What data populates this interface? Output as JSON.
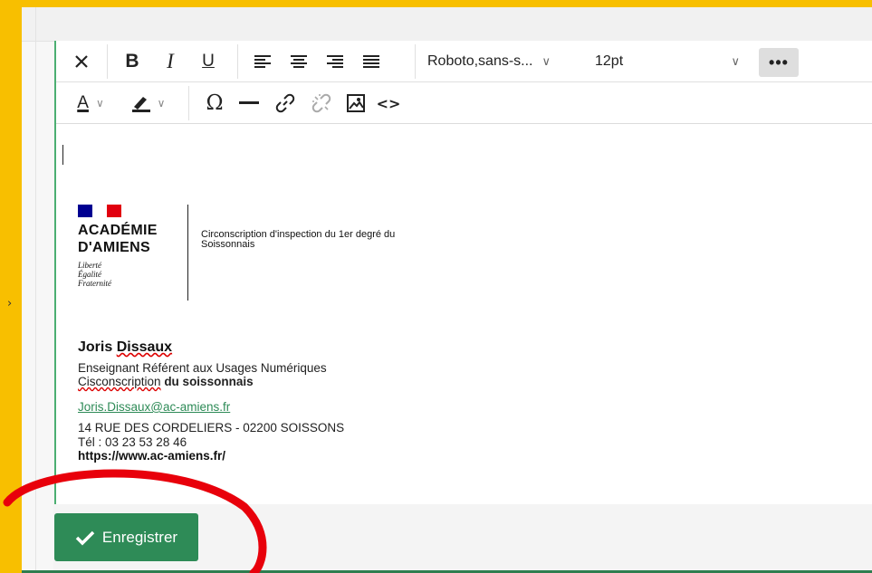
{
  "toolbar": {
    "row1": {
      "clear_icon": "close-icon",
      "bold_label": "B",
      "italic_label": "I",
      "underline_label": "U",
      "font_family": "Roboto,sans-s...",
      "font_size": "12pt",
      "more_label": "•••"
    },
    "row2": {
      "text_color_label": "A",
      "special_char_label": "Ω",
      "hr_label": "—",
      "code_label": "<>"
    }
  },
  "signature": {
    "logo": {
      "line1": "ACADÉMIE",
      "line2": "D'AMIENS",
      "motto1": "Liberté",
      "motto2": "Égalité",
      "motto3": "Fraternité"
    },
    "circonscription_line1": "Circonscription d'inspection du 1er degré du",
    "circonscription_line2": "Soissonnais",
    "name_first": "Joris",
    "name_last": "Dissaux",
    "role": "Enseignant Référent aux Usages Numériques",
    "circ_word": "Cisconscription",
    "circ_rest": "du soissonnais",
    "email": "Joris.Dissaux@ac-amiens.fr",
    "address": "14 RUE DES CORDELIERS - 02200 SOISSONS",
    "tel": "Tél : 03 23 53 28 46",
    "url": "https://www.ac-amiens.fr/"
  },
  "save_button": {
    "label": "Enregistrer"
  },
  "colors": {
    "frame": "#f8bf00",
    "accent_green": "#2e8b57",
    "annotation_red": "#e8000b"
  }
}
